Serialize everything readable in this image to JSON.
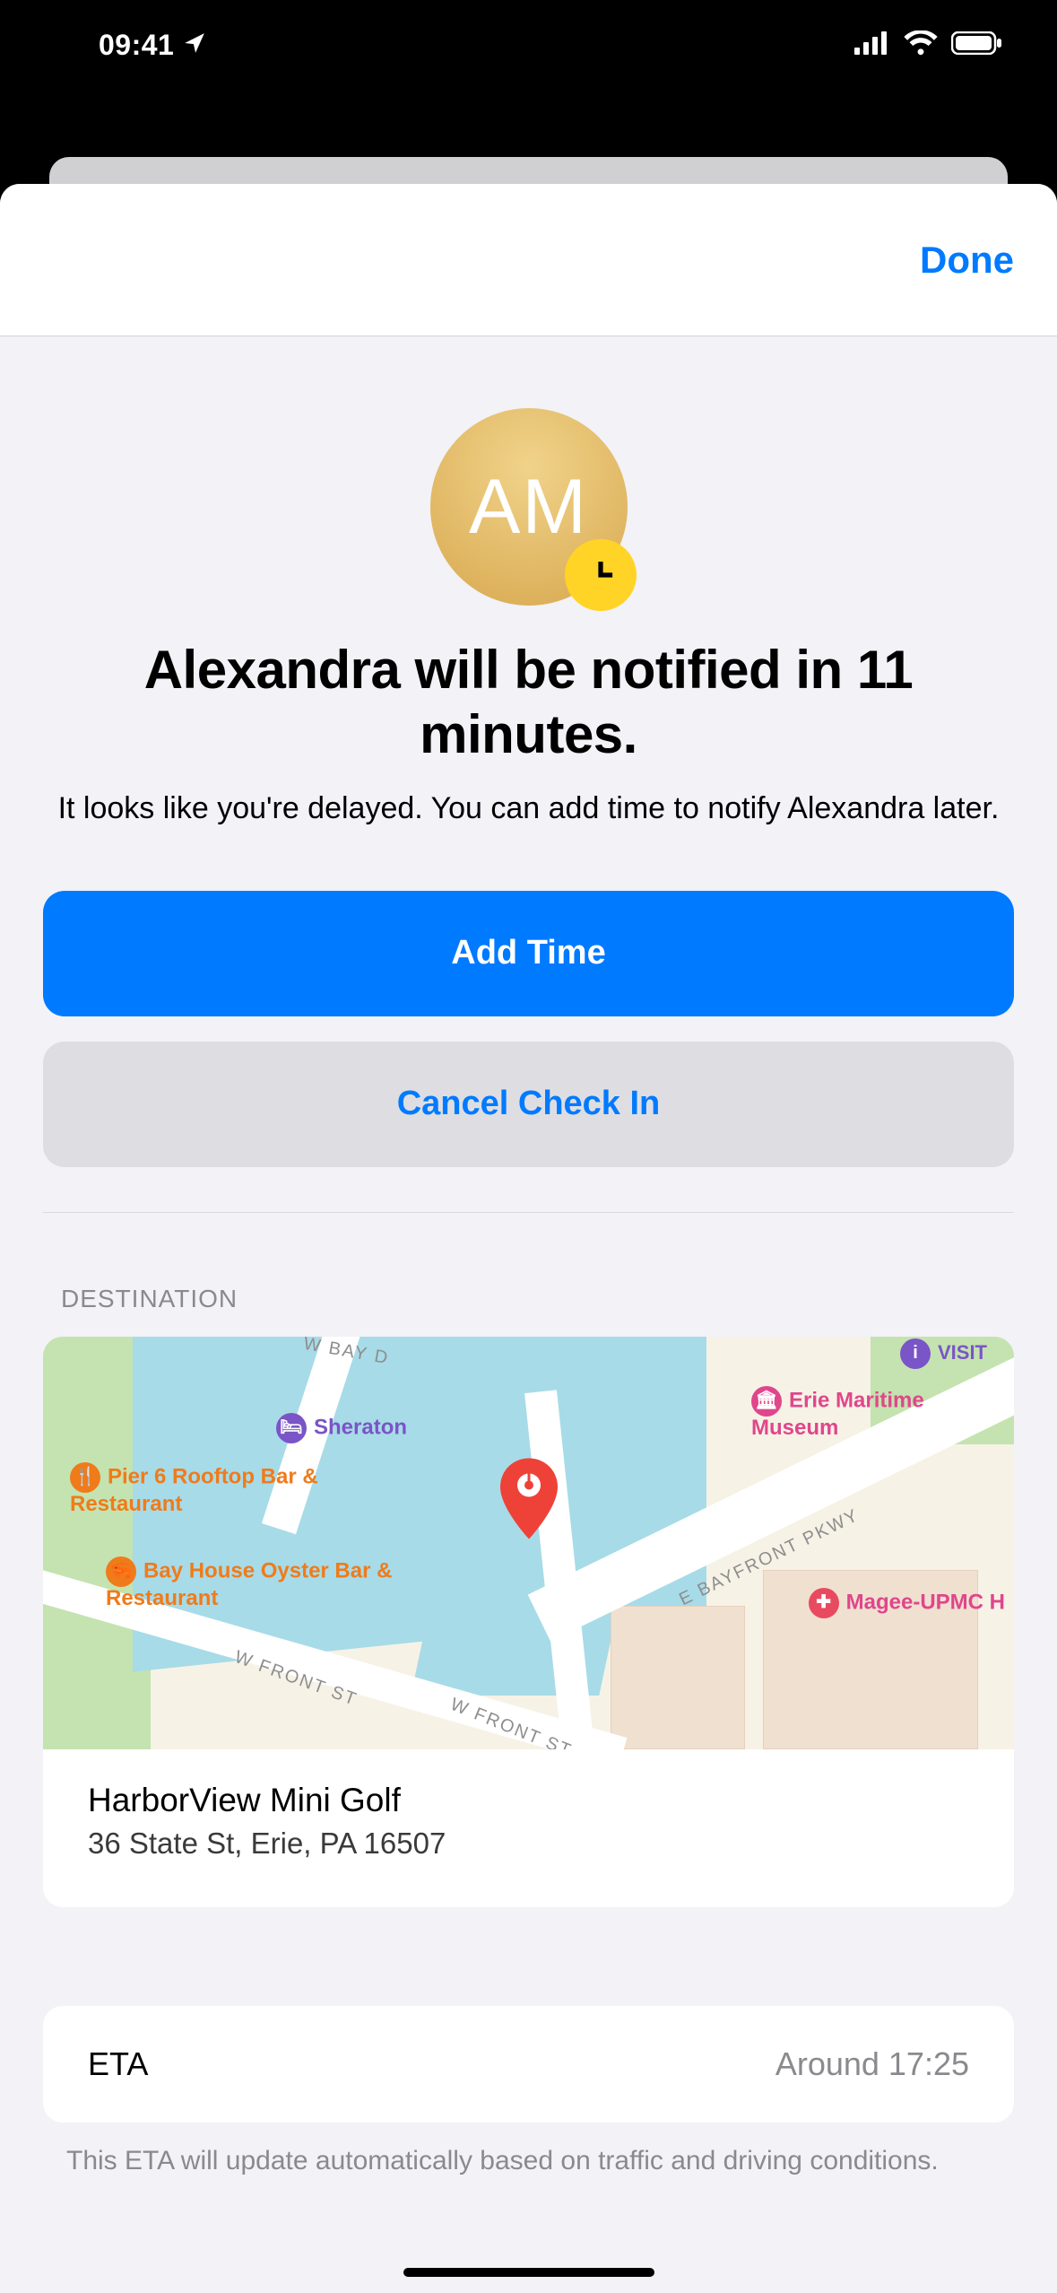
{
  "status_bar": {
    "time": "09:41"
  },
  "sheet": {
    "done_label": "Done",
    "avatar_initials": "AM",
    "title": "Alexandra will be notified in 11 minutes.",
    "subtitle": "It looks like you're delayed. You can add time to notify Alexandra later.",
    "primary_button": "Add Time",
    "secondary_button": "Cancel Check In"
  },
  "destination": {
    "section_header": "DESTINATION",
    "name": "HarborView Mini Golf",
    "address": "36 State St, Erie, PA  16507",
    "map_pois": {
      "sheraton": "Sheraton",
      "pier6": "Pier 6 Rooftop Bar & Restaurant",
      "bayhouse": "Bay House Oyster Bar & Restaurant",
      "erie_maritime": "Erie Maritime Museum",
      "magee": "Magee-UPMC H",
      "visit": "VISIT"
    },
    "map_roads": {
      "wbay": "W BAY D",
      "wfront1": "W FRONT ST",
      "wfront2": "W FRONT ST",
      "bayfront": "E BAYFRONT PKWY"
    }
  },
  "eta": {
    "label": "ETA",
    "value": "Around 17:25",
    "footer": "This ETA will update automatically based on traffic and driving conditions."
  }
}
